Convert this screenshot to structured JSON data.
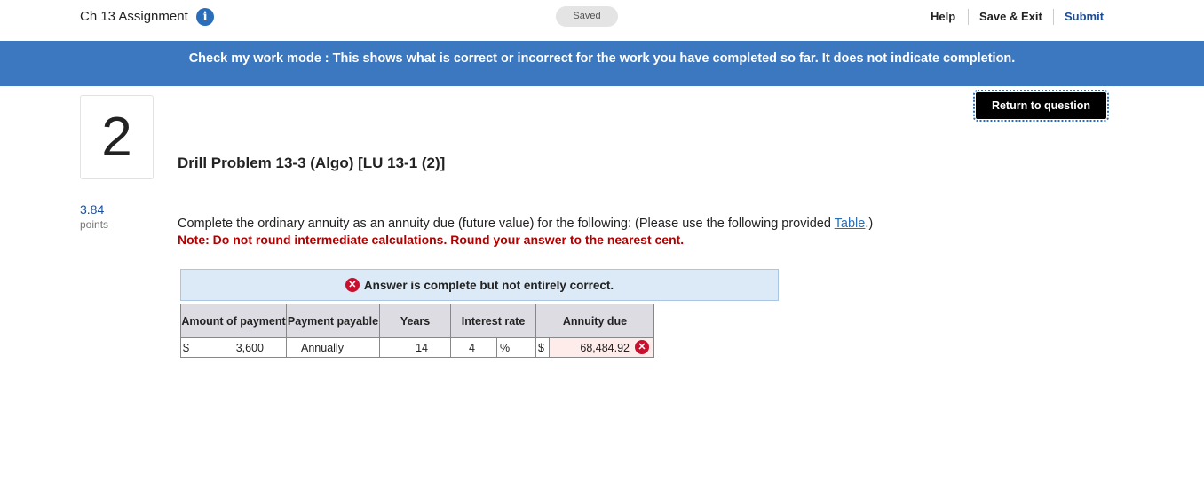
{
  "header": {
    "assignment_title": "Ch 13 Assignment",
    "info_icon": "i",
    "status": "Saved",
    "help": "Help",
    "save_exit": "Save & Exit",
    "submit": "Submit"
  },
  "banner": {
    "text": "Check my work mode : This shows what is correct or incorrect for the work you have completed so far. It does not indicate completion."
  },
  "return_button": "Return to question",
  "question": {
    "number": "2",
    "points_value": "3.84",
    "points_label": "points",
    "title": "Drill Problem 13-3 (Algo) [LU 13-1 (2)]",
    "instructions_pre": "Complete the ordinary annuity as an annuity due (future value) for the following: (Please use the following provided ",
    "table_link": "Table",
    "instructions_post": ".)",
    "note": "Note: Do not round intermediate calculations. Round your answer to the nearest cent."
  },
  "feedback": {
    "icon": "✕",
    "text": "Answer is complete but not entirely correct."
  },
  "answer_table": {
    "headers": {
      "amount": "Amount of payment",
      "payable": "Payment payable",
      "years": "Years",
      "rate": "Interest rate",
      "annuity": "Annuity due"
    },
    "row": {
      "amount_currency": "$",
      "amount": "3,600",
      "payable": "Annually",
      "years": "14",
      "rate": "4",
      "rate_unit": "%",
      "annuity_currency": "$",
      "annuity_value": "68,484.92",
      "status_icon": "✕"
    }
  },
  "colors": {
    "banner": "#3b78c0",
    "link": "#2a6ebb",
    "note_red": "#b00000",
    "error_icon": "#c8102e",
    "feedback_bg": "#dceaf7"
  }
}
